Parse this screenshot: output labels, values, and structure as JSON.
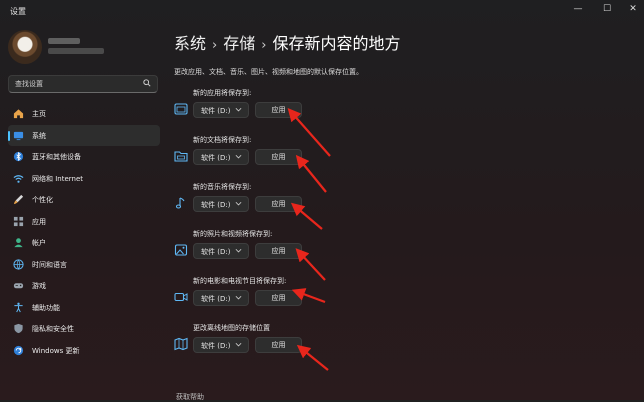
{
  "window": {
    "title": "设置",
    "controls": {
      "minimize": "—",
      "maximize": "☐",
      "close": "✕"
    }
  },
  "search": {
    "placeholder": "查找设置"
  },
  "sidebar": {
    "items": [
      {
        "label": "主页",
        "icon": "home-icon",
        "active": false
      },
      {
        "label": "系统",
        "icon": "system-icon",
        "active": true
      },
      {
        "label": "蓝牙和其他设备",
        "icon": "bluetooth-icon",
        "active": false
      },
      {
        "label": "网络和 Internet",
        "icon": "wifi-icon",
        "active": false
      },
      {
        "label": "个性化",
        "icon": "brush-icon",
        "active": false
      },
      {
        "label": "应用",
        "icon": "apps-icon",
        "active": false
      },
      {
        "label": "帐户",
        "icon": "account-icon",
        "active": false
      },
      {
        "label": "时间和语言",
        "icon": "globe-clock-icon",
        "active": false
      },
      {
        "label": "游戏",
        "icon": "gamepad-icon",
        "active": false
      },
      {
        "label": "辅助功能",
        "icon": "accessibility-icon",
        "active": false
      },
      {
        "label": "隐私和安全性",
        "icon": "shield-icon",
        "active": false
      },
      {
        "label": "Windows 更新",
        "icon": "update-icon",
        "active": false
      }
    ]
  },
  "breadcrumb": {
    "level1": "系统",
    "level2": "存储",
    "current": "保存新内容的地方"
  },
  "main": {
    "description": "更改应用、文档、音乐、图片、视频和地图的默认保存位置。",
    "rows": [
      {
        "label": "新的应用将保存到:",
        "icon": "app-window-icon",
        "drive": "软件 (D:)",
        "button": "应用"
      },
      {
        "label": "新的文档将保存到:",
        "icon": "folder-icon",
        "drive": "软件 (D:)",
        "button": "应用"
      },
      {
        "label": "新的音乐将保存到:",
        "icon": "music-note-icon",
        "drive": "软件 (D:)",
        "button": "应用"
      },
      {
        "label": "新的照片和视频将保存到:",
        "icon": "photo-icon",
        "drive": "软件 (D:)",
        "button": "应用"
      },
      {
        "label": "新的电影和电视节目将保存到:",
        "icon": "video-camera-icon",
        "drive": "软件 (D:)",
        "button": "应用"
      },
      {
        "label": "更改离线地图的存储位置",
        "icon": "map-icon",
        "drive": "软件 (D:)",
        "button": "应用"
      }
    ],
    "help": "获取帮助"
  },
  "colors": {
    "accent": "#4cc2ff",
    "annotation_arrow": "#e8261c",
    "icon_blue": "#5fb8f5"
  }
}
